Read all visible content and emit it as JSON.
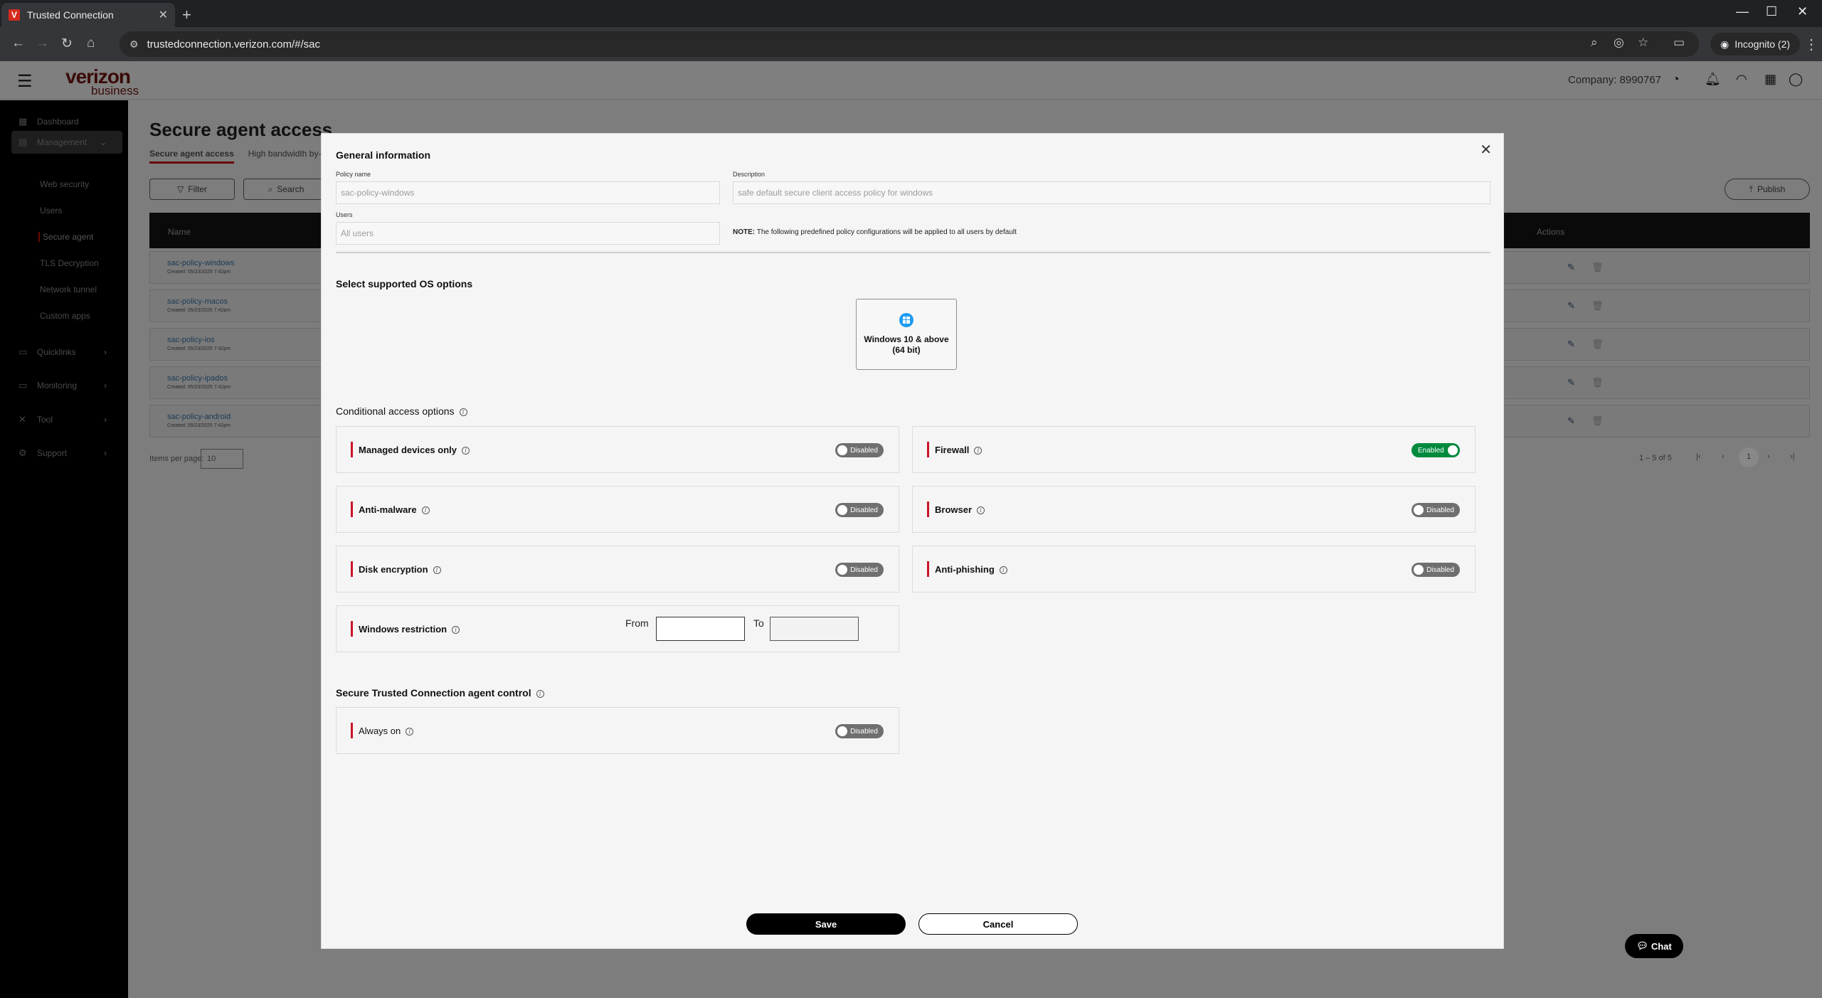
{
  "browser": {
    "tab_title": "Trusted Connection",
    "favicon_letter": "V",
    "url": "trustedconnection.verizon.com/#/sac",
    "profile_label": "Incognito (2)"
  },
  "header": {
    "logo_line1": "verizon",
    "logo_line2": "business",
    "company": "Company: 8990767"
  },
  "sidebar": {
    "items": [
      {
        "label": "Dashboard"
      },
      {
        "label": "Management"
      },
      {
        "label": "Quicklinks"
      },
      {
        "label": "Monitoring"
      },
      {
        "label": "Tool"
      },
      {
        "label": "Support"
      }
    ],
    "sub_items": [
      {
        "label": "Web security"
      },
      {
        "label": "Users"
      },
      {
        "label": "Secure agent"
      },
      {
        "label": "TLS Decryption"
      },
      {
        "label": "Network tunnel"
      },
      {
        "label": "Custom apps"
      }
    ]
  },
  "page": {
    "title": "Secure agent access",
    "tabs": [
      "Secure agent access",
      "High bandwidth by-"
    ],
    "filter_label": "Filter",
    "search_label": "Search",
    "publish_label": "Publish",
    "col_name": "Name",
    "col_actions": "Actions",
    "rows": [
      {
        "name": "sac-policy-windows",
        "created": "Created: 05/23/2025 7:42pm"
      },
      {
        "name": "sac-policy-macos",
        "created": "Created: 05/23/2025 7:42pm"
      },
      {
        "name": "sac-policy-ios",
        "created": "Created: 05/23/2025 7:42pm"
      },
      {
        "name": "sac-policy-ipados",
        "created": "Created: 05/23/2025 7:42pm"
      },
      {
        "name": "sac-policy-android",
        "created": "Created: 05/23/2025 7:42pm"
      }
    ],
    "items_per_page_label": "Items per page:",
    "items_per_page": "10",
    "range": "1 – 5 of 5",
    "current_page": "1",
    "chat_label": "Chat"
  },
  "modal": {
    "general_title": "General information",
    "policy_name_label": "Policy name",
    "policy_name_value": "sac-policy-windows",
    "description_label": "Description",
    "description_value": "safe default secure client access policy for windows",
    "users_label": "Users",
    "users_placeholder": "All users",
    "note_prefix": "NOTE:",
    "note_text": "The following predefined policy configurations will be applied to all users by default",
    "os_title": "Select supported OS options",
    "os_option_line1": "Windows 10 & above",
    "os_option_line2": "(64 bit)",
    "conditional_title": "Conditional access options",
    "options": [
      {
        "label": "Managed devices only",
        "state": "Disabled"
      },
      {
        "label": "Firewall",
        "state": "Enabled"
      },
      {
        "label": "Anti-malware",
        "state": "Disabled"
      },
      {
        "label": "Browser",
        "state": "Disabled"
      },
      {
        "label": "Disk encryption",
        "state": "Disabled"
      },
      {
        "label": "Anti-phishing",
        "state": "Disabled"
      },
      {
        "label": "Windows restriction"
      }
    ],
    "from_label": "From",
    "to_label": "To",
    "agent_control_title": "Secure Trusted Connection agent control",
    "always_on_label": "Always on",
    "always_on_state": "Disabled",
    "save_label": "Save",
    "cancel_label": "Cancel"
  },
  "colors": {
    "brand_red": "#c9142a",
    "enabled_green": "#008a3e",
    "toggle_off": "#6f6f6f"
  }
}
